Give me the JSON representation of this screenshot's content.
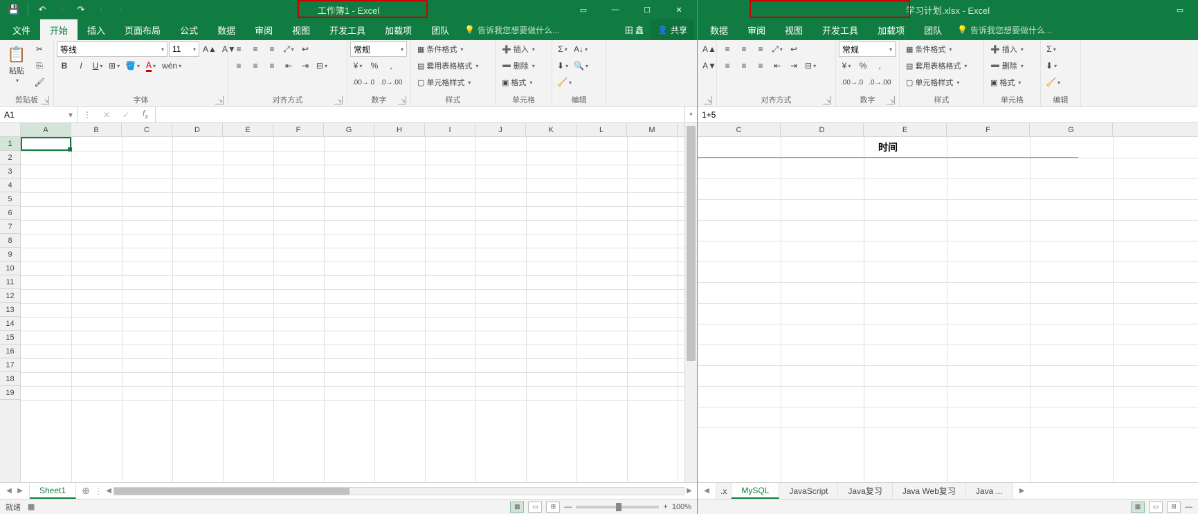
{
  "left": {
    "title": "工作簿1 - Excel",
    "qat": {
      "save": "💾",
      "undo": "↶",
      "redo": "↷"
    },
    "winctrl": {
      "rib": "▭",
      "min": "—",
      "max": "☐",
      "close": "✕"
    },
    "user_name": "田 鑫",
    "share_label": "共享",
    "tabs": [
      "文件",
      "开始",
      "插入",
      "页面布局",
      "公式",
      "数据",
      "审阅",
      "视图",
      "开发工具",
      "加载项",
      "团队"
    ],
    "active_tab": 1,
    "tell_me": "告诉我您想要做什么...",
    "ribbon": {
      "clipboard": {
        "paste": "粘贴",
        "label": "剪贴板"
      },
      "font": {
        "name": "等线",
        "size": "11",
        "label": "字体"
      },
      "align": {
        "label": "对齐方式"
      },
      "number": {
        "format": "常规",
        "label": "数字"
      },
      "styles": {
        "cond": "条件格式",
        "table": "套用表格格式",
        "cell": "单元格样式",
        "label": "样式"
      },
      "cells": {
        "insert": "插入",
        "delete": "删除",
        "format": "格式",
        "label": "单元格"
      },
      "editing": {
        "label": "编辑"
      }
    },
    "name_box": "A1",
    "formula": "",
    "cols": [
      "A",
      "B",
      "C",
      "D",
      "E",
      "F",
      "G",
      "H",
      "I",
      "J",
      "K",
      "L",
      "M"
    ],
    "rows": 19,
    "sheets": [
      "Sheet1"
    ],
    "active_sheet": 0,
    "status": "就绪",
    "zoom": "100%"
  },
  "right": {
    "title": "学习计划.xlsx - Excel",
    "tabs_visible": [
      "数据",
      "审阅",
      "视图",
      "开发工具",
      "加载项",
      "团队"
    ],
    "tell_me": "告诉我您想要做什么...",
    "ribbon": {
      "align": {
        "label": "对齐方式"
      },
      "number": {
        "format": "常规",
        "label": "数字"
      },
      "styles": {
        "cond": "条件格式",
        "table": "套用表格格式",
        "cell": "单元格样式",
        "label": "样式"
      },
      "cells": {
        "insert": "插入",
        "delete": "删除",
        "format": "格式",
        "label": "单元格"
      },
      "editing": {
        "label": "编辑"
      }
    },
    "formula": "1+5",
    "cols": [
      "C",
      "D",
      "E",
      "F",
      "G"
    ],
    "header_text": "时间",
    "sheets": [
      ".x",
      "MySQL",
      "JavaScript",
      "Java复习",
      "Java Web复习",
      "Java ..."
    ],
    "active_sheet": 1
  }
}
